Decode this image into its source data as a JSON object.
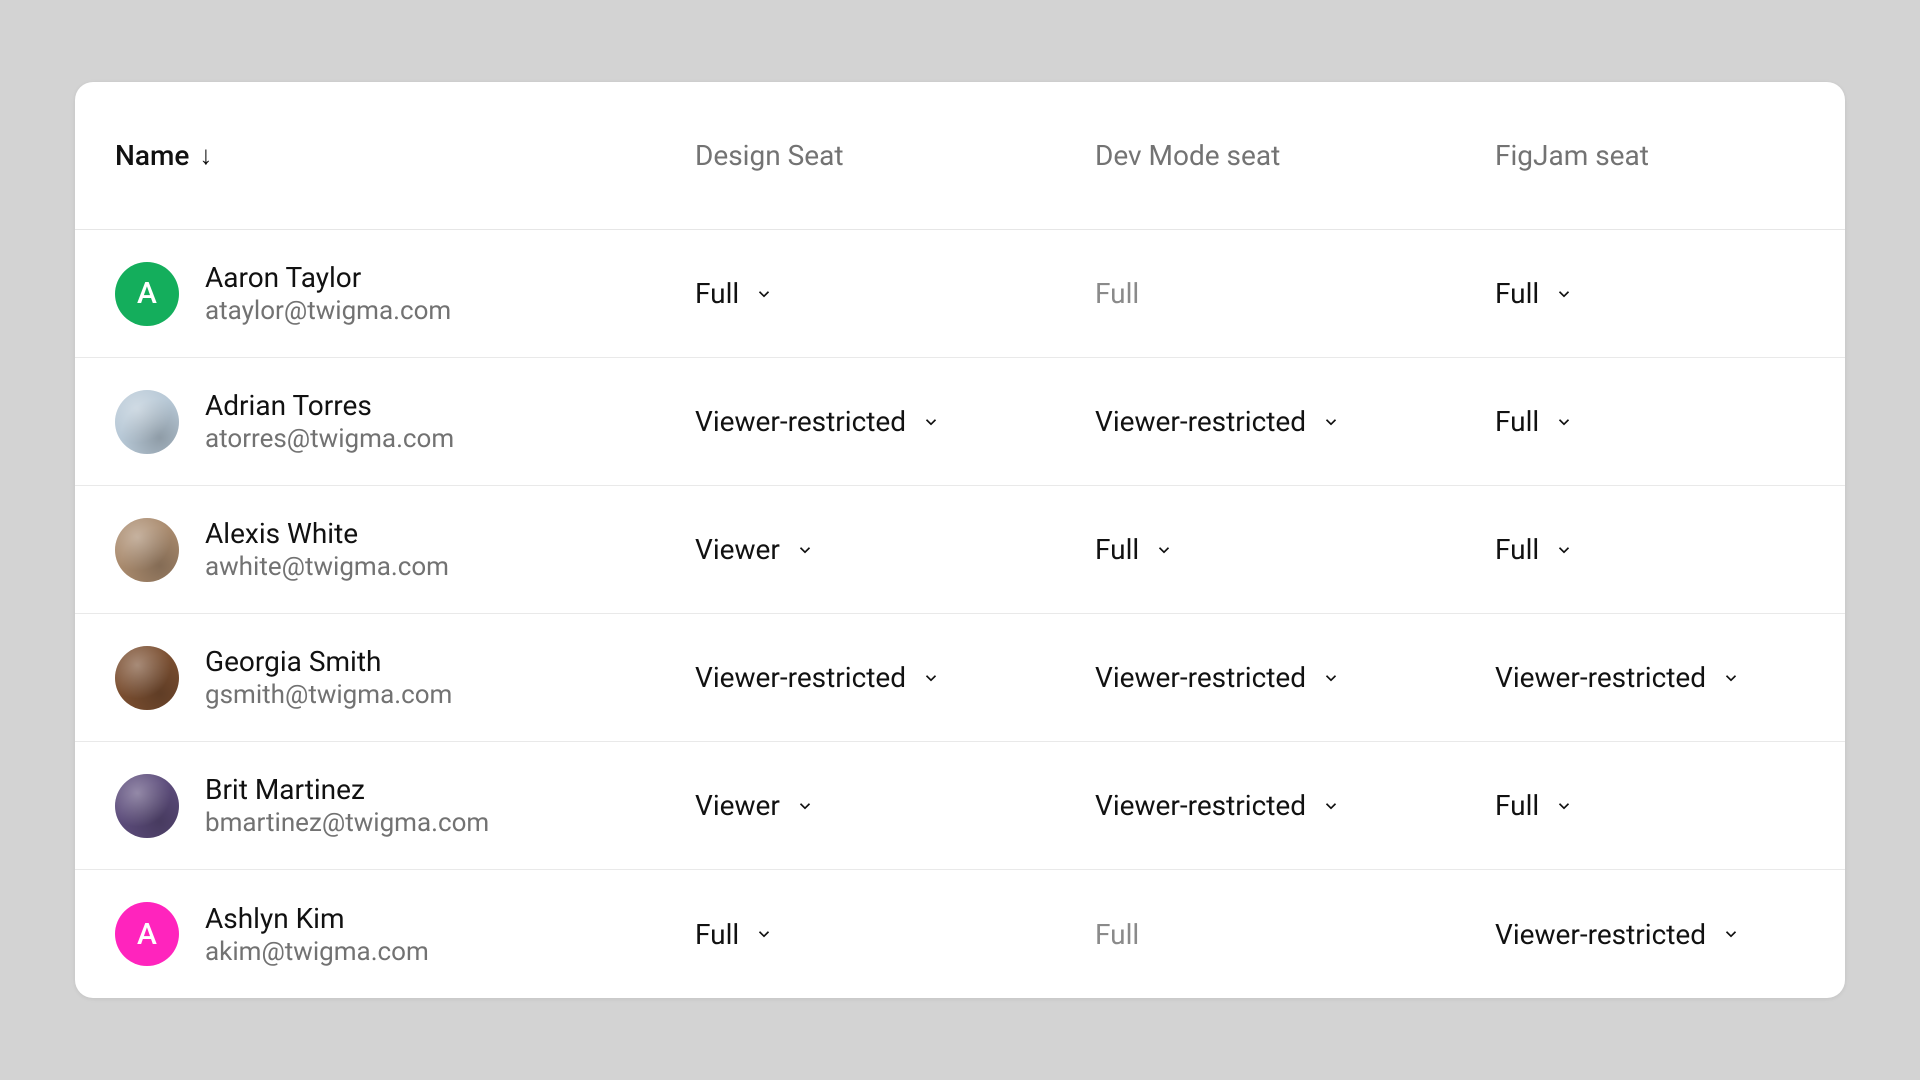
{
  "columns": {
    "name": "Name",
    "design": "Design Seat",
    "dev": "Dev Mode seat",
    "figjam": "FigJam seat"
  },
  "sort_indicator": "↓",
  "rows": [
    {
      "name": "Aaron Taylor",
      "email": "ataylor@twigma.com",
      "avatar": {
        "type": "letter",
        "letter": "A",
        "class": "avatar-green"
      },
      "design": {
        "label": "Full",
        "editable": true
      },
      "dev": {
        "label": "Full",
        "editable": false
      },
      "figjam": {
        "label": "Full",
        "editable": true
      }
    },
    {
      "name": "Adrian Torres",
      "email": "atorres@twigma.com",
      "avatar": {
        "type": "photo",
        "class": "avatar-photo1"
      },
      "design": {
        "label": "Viewer-restricted",
        "editable": true
      },
      "dev": {
        "label": "Viewer-restricted",
        "editable": true
      },
      "figjam": {
        "label": "Full",
        "editable": true
      }
    },
    {
      "name": "Alexis White",
      "email": "awhite@twigma.com",
      "avatar": {
        "type": "photo",
        "class": "avatar-photo2"
      },
      "design": {
        "label": "Viewer",
        "editable": true
      },
      "dev": {
        "label": "Full",
        "editable": true
      },
      "figjam": {
        "label": "Full",
        "editable": true
      }
    },
    {
      "name": "Georgia Smith",
      "email": "gsmith@twigma.com",
      "avatar": {
        "type": "photo",
        "class": "avatar-photo3"
      },
      "design": {
        "label": "Viewer-restricted",
        "editable": true
      },
      "dev": {
        "label": "Viewer-restricted",
        "editable": true
      },
      "figjam": {
        "label": "Viewer-restricted",
        "editable": true
      }
    },
    {
      "name": "Brit Martinez",
      "email": "bmartinez@twigma.com",
      "avatar": {
        "type": "photo",
        "class": "avatar-photo4"
      },
      "design": {
        "label": "Viewer",
        "editable": true
      },
      "dev": {
        "label": "Viewer-restricted",
        "editable": true
      },
      "figjam": {
        "label": "Full",
        "editable": true
      }
    },
    {
      "name": "Ashlyn Kim",
      "email": "akim@twigma.com",
      "avatar": {
        "type": "letter",
        "letter": "A",
        "class": "avatar-pink"
      },
      "design": {
        "label": "Full",
        "editable": true
      },
      "dev": {
        "label": "Full",
        "editable": false
      },
      "figjam": {
        "label": "Viewer-restricted",
        "editable": true
      }
    }
  ]
}
